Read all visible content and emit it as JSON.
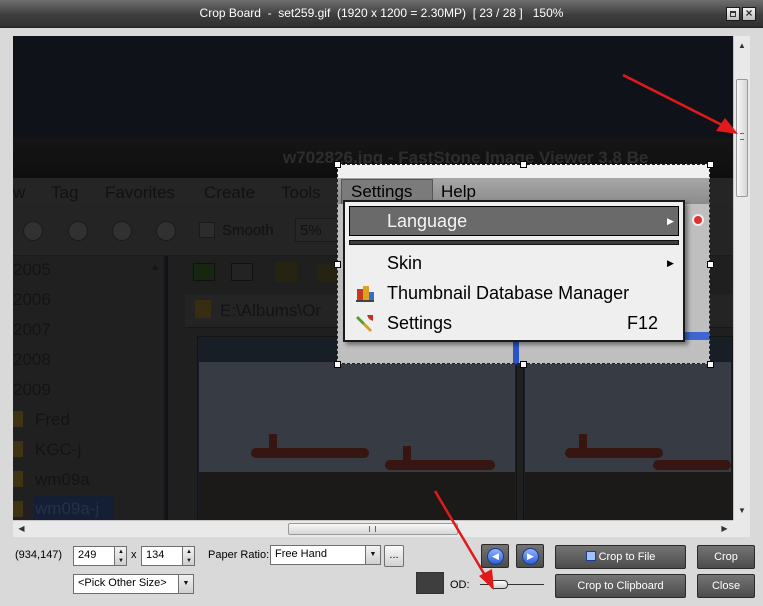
{
  "window": {
    "title": "Crop Board  -  set259.gif  (1920 x 1200 = 2.30MP)  [ 23 / 28 ]   150%"
  },
  "screenshot": {
    "title_text": "w702826.jpg  -  FastStone Image Viewer 3.8 Be",
    "menubar": [
      "w",
      "Tag",
      "Favorites",
      "Create",
      "Tools"
    ],
    "toolbar": {
      "smooth_label": "Smooth",
      "zoom_value": "5%"
    },
    "folders": [
      "2005",
      "2006",
      "2007",
      "2008",
      "2009",
      "Fred",
      "KGC-j",
      "wm09a",
      "wm09a-j"
    ],
    "path": "E:\\Albums\\Or",
    "menu_tabs": {
      "settings": "Settings",
      "help": "Help"
    },
    "dropdown": {
      "language": "Language",
      "skin": "Skin",
      "thumb_db": "Thumbnail Database Manager",
      "settings": "Settings",
      "settings_shortcut": "F12"
    }
  },
  "controls": {
    "position": "(934,147)",
    "width": "249",
    "times": "x",
    "height": "134",
    "size_combo": "<Pick Other Size>",
    "paper_ratio_label": "Paper Ratio:",
    "paper_ratio_value": "Free Hand",
    "ellipsis": "...",
    "od_label": "OD:",
    "buttons": {
      "crop_to_file": "Crop to File",
      "crop": "Crop",
      "crop_to_clipboard": "Crop to Clipboard",
      "close": "Close"
    }
  },
  "colors": {
    "title_gradient_top": "#6e6e6e",
    "panel_bg": "#d9d9d9",
    "button_bg": "#5c5c5c",
    "annotation_arrow": "#e01a1a",
    "selection_highlight": "#283a66"
  }
}
